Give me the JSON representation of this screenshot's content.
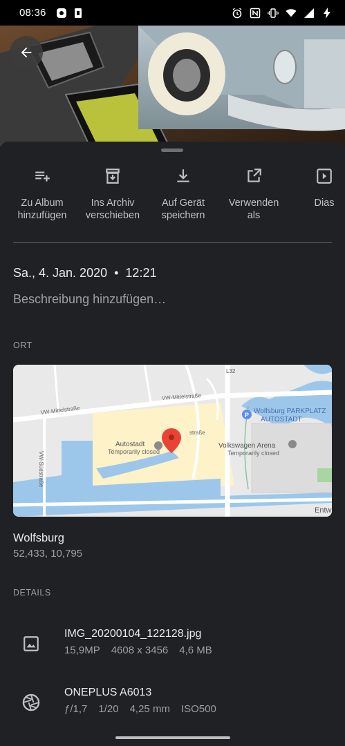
{
  "status": {
    "time": "08:36"
  },
  "actions": [
    {
      "label": "Zu Album\nhinzufügen",
      "icon": "playlist-add-icon"
    },
    {
      "label": "Ins Archiv\nverschieben",
      "icon": "archive-icon"
    },
    {
      "label": "Auf Gerät\nspeichern",
      "icon": "download-icon"
    },
    {
      "label": "Verwenden\nals",
      "icon": "open-in-new-icon"
    },
    {
      "label": "Dias",
      "icon": "slideshow-icon"
    }
  ],
  "info": {
    "date": "Sa., 4. Jan. 2020",
    "separator": "•",
    "time": "12:21",
    "description_placeholder": "Beschreibung hinzufügen…"
  },
  "location": {
    "section_label": "ORT",
    "map_labels": {
      "street1": "VW-Mittelstraße",
      "street2": "VW-Mittelstraße",
      "street3": "VW-Südstraße",
      "street4": "straße",
      "road": "L32",
      "poi1_name": "Autostadt",
      "poi1_status": "Temporarily closed",
      "poi2_name": "Volkswagen Arena",
      "poi2_status": "Temporarily closed",
      "poi3_name": "Wolfsburg PARKPLATZ",
      "poi3_sub": "AUTOSTADT",
      "edge": "Entw"
    },
    "place": "Wolfsburg",
    "coords": "52,433, 10,795"
  },
  "details": {
    "section_label": "DETAILS",
    "file": {
      "name": "IMG_20200104_122128.jpg",
      "megapixels": "15,9MP",
      "resolution": "4608 x 3456",
      "size": "4,6 MB"
    },
    "camera": {
      "model": "ONEPLUS A6013",
      "aperture": "ƒ/1,7",
      "shutter": "1/20",
      "focal": "4,25 mm",
      "iso": "ISO500"
    }
  },
  "colors": {
    "sheet_bg": "#202124",
    "primary_text": "#e8eaed",
    "secondary_text": "#9aa0a6",
    "map_pin": "#ea4335"
  }
}
